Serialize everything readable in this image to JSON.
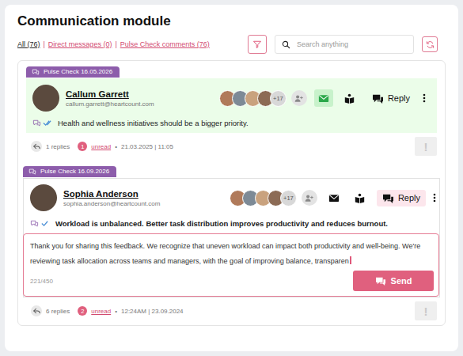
{
  "title": "Communication module",
  "tabs": [
    {
      "label": "All (76)",
      "selected": true
    },
    {
      "label": "Direct messages (0)",
      "selected": false
    },
    {
      "label": "Pulse Check comments (76)",
      "selected": false
    }
  ],
  "tab_separator": "|",
  "search": {
    "placeholder": "Search anything"
  },
  "posts": [
    {
      "tag": "Pulse Check 16.05.2026",
      "name": "Callum Garrett",
      "email": "callum.garrett@heartcount.com",
      "group_avatars": 4,
      "group_more": "+17",
      "highlighted": true,
      "mail_marked": true,
      "reply_active": false,
      "double_check": true,
      "expanded": false,
      "reply_label": "Reply",
      "message": "Health and wellness initiatives should be a bigger priority.",
      "replies": "1 replies",
      "unread_count": "1",
      "unread_label": "unread",
      "bullet": "•",
      "timestamp": "21.03.2025 | 11:05",
      "flag": "!"
    },
    {
      "tag": "Pulse Check 16.09.2026",
      "name": "Sophia Anderson",
      "email": "sophia.anderson@heartcount.com",
      "group_avatars": 4,
      "group_more": "+17",
      "highlighted": false,
      "mail_marked": false,
      "reply_active": true,
      "double_check": false,
      "expanded": true,
      "reply_label": "Reply",
      "message": "Workload is unbalanced. Better task distribution improves productivity and reduces burnout.",
      "draft": {
        "text": "Thank you for sharing this feedback. We recognize that uneven workload can impact both productivity and well-being. We're reviewing task allocation across teams and managers, with the goal of improving balance, transparen",
        "counter": "221/450",
        "send_label": "Send"
      },
      "replies": "6 replies",
      "unread_count": "2",
      "unread_label": "unread",
      "bullet": "•",
      "timestamp": "12:24AM | 23.09.2024",
      "flag": "!"
    }
  ]
}
